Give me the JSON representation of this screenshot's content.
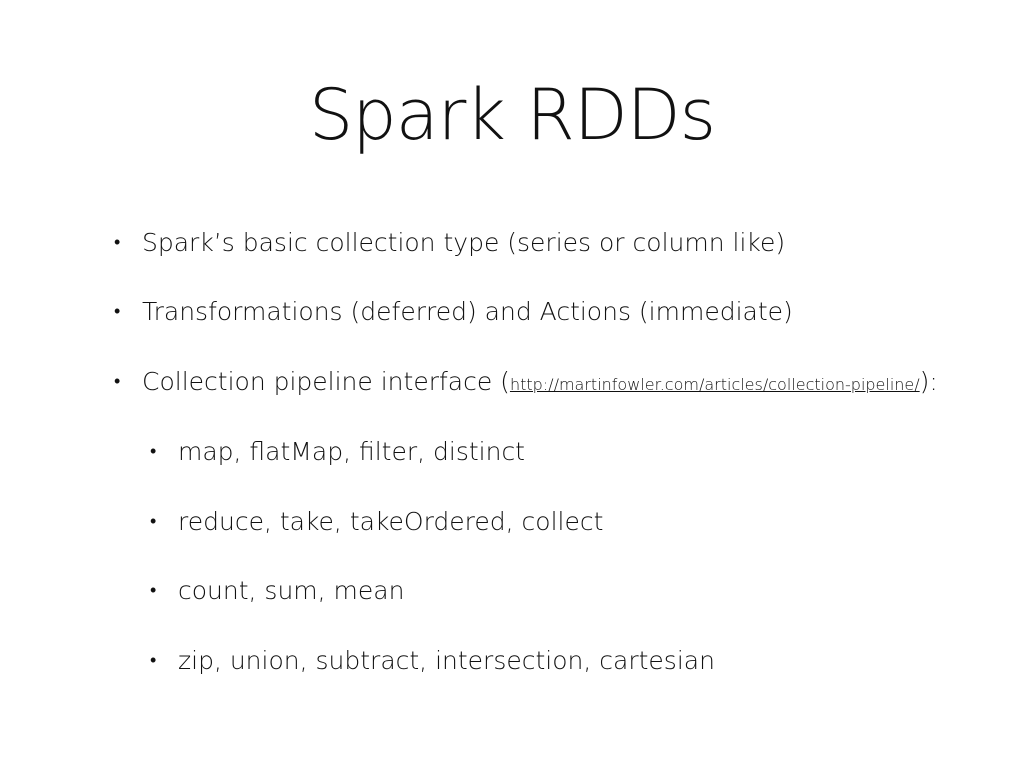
{
  "slide": {
    "title": "Spark RDDs",
    "bullet_symbol": "•",
    "bullets": [
      {
        "text": "Spark’s basic collection type (series or column like)"
      },
      {
        "text": "Transformations (deferred) and Actions (immediate)"
      },
      {
        "text_before": "Collection pipeline interface (",
        "link": "http://martinfowler.com/articles/collection-pipeline/",
        "text_after": "):"
      }
    ],
    "sub_bullets": [
      {
        "text": "map, flatMap, filter, distinct"
      },
      {
        "text": "reduce, take, takeOrdered, collect"
      },
      {
        "text": "count, sum, mean"
      },
      {
        "text": "zip, union, subtract, intersection, cartesian"
      }
    ]
  }
}
